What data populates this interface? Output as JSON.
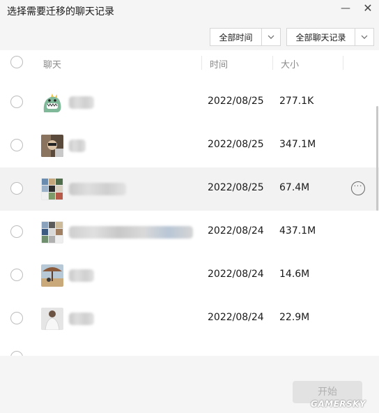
{
  "window": {
    "title": "选择需要迁移的聊天记录",
    "minimize_glyph": "—",
    "close_glyph": "✕"
  },
  "filters": {
    "time": {
      "selected": "全部时间",
      "icon": "chevron-down-icon"
    },
    "chats": {
      "selected": "全部聊天记录",
      "icon": "chevron-down-icon"
    }
  },
  "header": {
    "chat": "聊天",
    "time": "时间",
    "size": "大小"
  },
  "rows": [
    {
      "date": "2022/08/25",
      "size": "277.1K",
      "avatar": "cartoon-dinosaur",
      "name_hidden": true
    },
    {
      "date": "2022/08/25",
      "size": "347.1M",
      "avatar": "photo",
      "name_hidden": true
    },
    {
      "date": "2022/08/25",
      "size": "67.4M",
      "avatar": "group-grid",
      "name_hidden": true,
      "highlighted": true,
      "more_glyph": "···"
    },
    {
      "date": "2022/08/24",
      "size": "437.1M",
      "avatar": "group-grid",
      "name_hidden": true
    },
    {
      "date": "2022/08/24",
      "size": "14.6M",
      "avatar": "beach-umbrella",
      "name_hidden": true
    },
    {
      "date": "2022/08/24",
      "size": "22.9M",
      "avatar": "person-photo",
      "name_hidden": true
    }
  ],
  "footer": {
    "start_label": "开始"
  },
  "watermark": "GAMERSKY",
  "colors": {
    "highlight_row": "#f2f2f2",
    "background": "#f5f5f5",
    "list_background": "#ffffff"
  }
}
